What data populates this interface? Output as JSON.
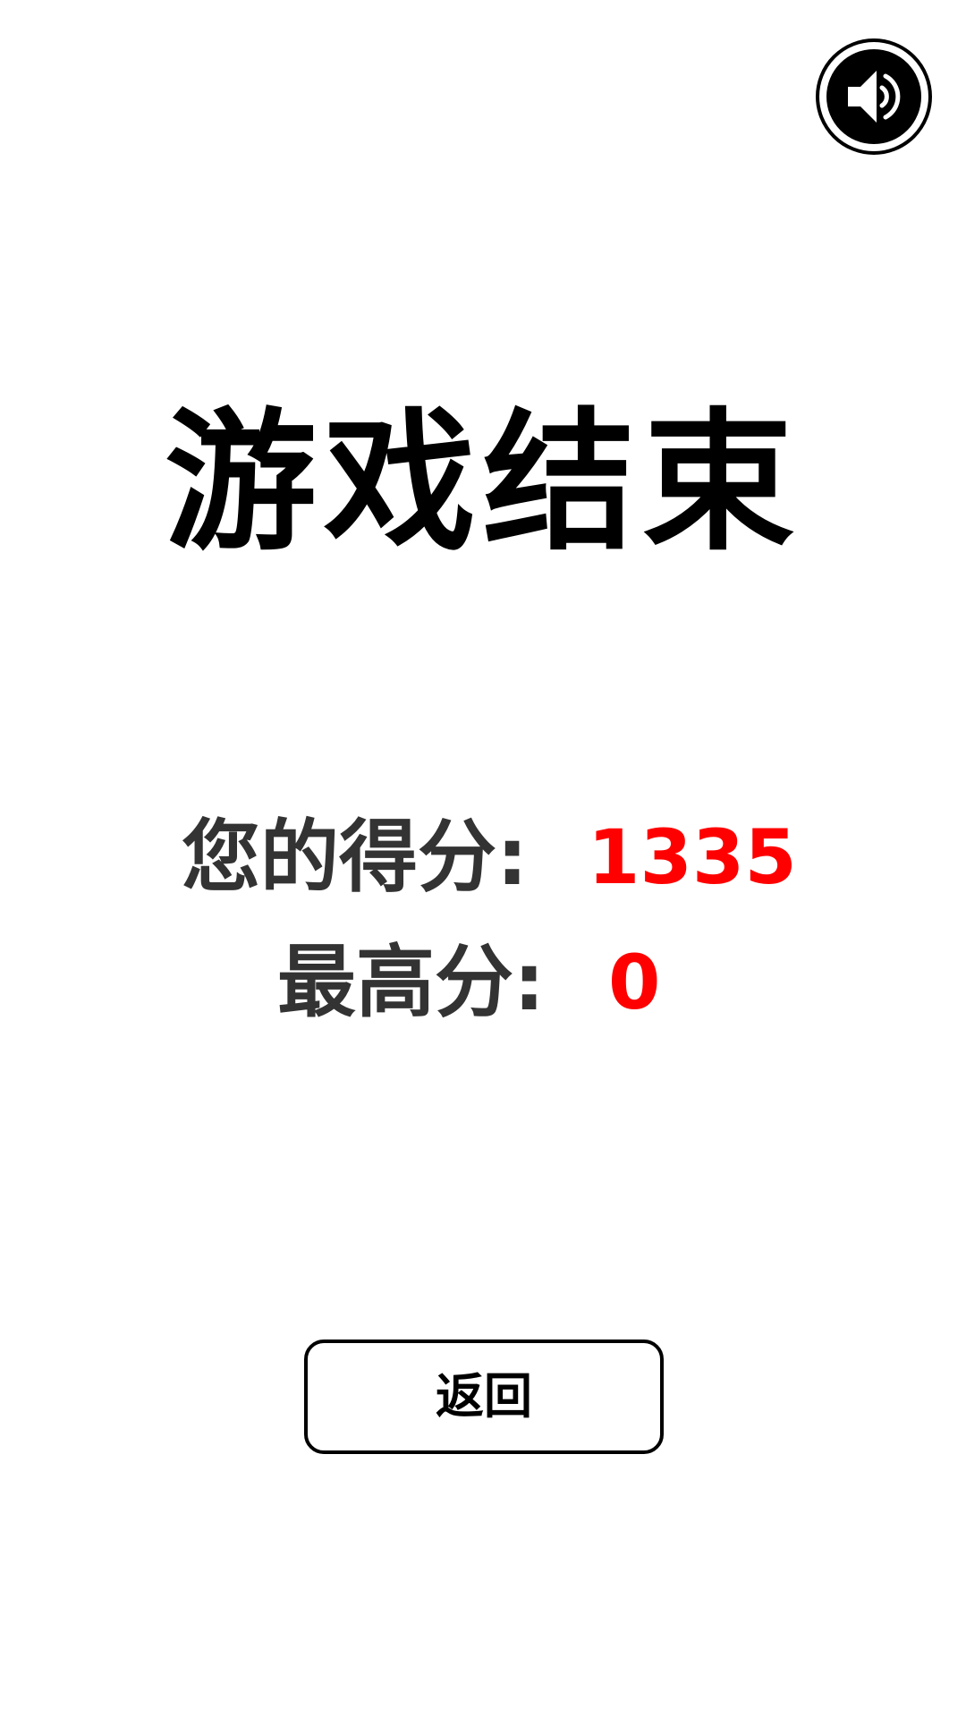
{
  "sound": {
    "icon": "speaker-icon",
    "state": "on"
  },
  "title": "游戏结束",
  "score": {
    "label": "您的得分:",
    "value": "1335"
  },
  "best": {
    "label": "最高分:",
    "value": "0"
  },
  "back_button": {
    "label": "返回"
  },
  "colors": {
    "background": "#ffffff",
    "title": "#000000",
    "label": "#333333",
    "value": "#ff0000"
  }
}
